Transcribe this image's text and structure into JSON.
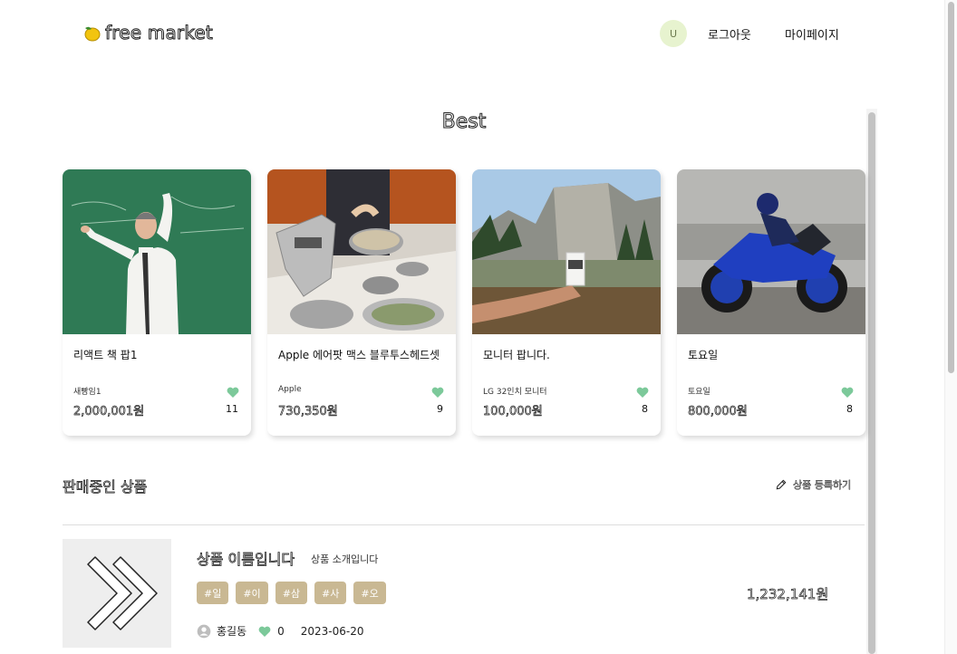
{
  "header": {
    "logo_text": "free market",
    "logo_icon": "lemon-icon",
    "avatar_initial": "U",
    "logout_label": "로그아웃",
    "mypage_label": "마이페이지"
  },
  "best": {
    "title": "Best",
    "cards": [
      {
        "name": "리액트 책 팝1",
        "seller": "새빵임1",
        "price": "2,000,001원",
        "likes": "11"
      },
      {
        "name": "Apple 에어팟 맥스 블루투스헤드셋",
        "seller": "Apple",
        "price": "730,350원",
        "likes": "9"
      },
      {
        "name": "모니터 팝니다.",
        "seller": "LG 32인치 모니터",
        "price": "100,000원",
        "likes": "8"
      },
      {
        "name": "토요일",
        "seller": "토요일",
        "price": "800,000원",
        "likes": "8"
      }
    ]
  },
  "selling": {
    "title": "판매중인 상품",
    "register_label": "상품 등록하기",
    "product": {
      "name": "상품 이름입니다",
      "description": "상품 소개입니다",
      "tags": [
        "#일",
        "#이",
        "#삼",
        "#사",
        "#오"
      ],
      "price": "1,232,141원",
      "seller": "홍길동",
      "likes": "0",
      "date": "2023-06-20"
    }
  },
  "colors": {
    "heart": "#7cc99a",
    "tag_bg": "#c9b893",
    "avatar_bg": "#e7f3cf"
  }
}
